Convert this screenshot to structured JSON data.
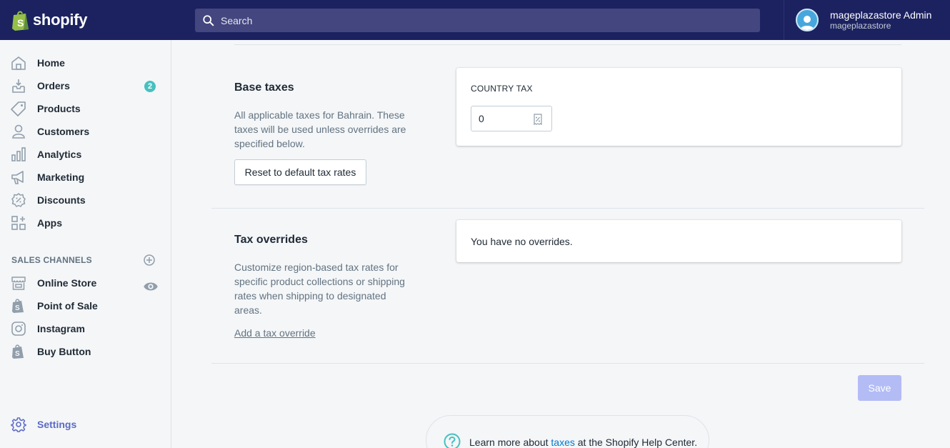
{
  "brand": {
    "name": "shopify",
    "color": "#1c2260",
    "accent": "#5c6ac4"
  },
  "search": {
    "placeholder": "Search"
  },
  "user": {
    "name": "mageplazastore Admin",
    "store": "mageplazastore"
  },
  "sidebar": {
    "items": [
      {
        "label": "Home",
        "icon": "home-icon"
      },
      {
        "label": "Orders",
        "icon": "orders-icon",
        "badge": "2"
      },
      {
        "label": "Products",
        "icon": "tag-icon"
      },
      {
        "label": "Customers",
        "icon": "person-icon"
      },
      {
        "label": "Analytics",
        "icon": "bar-chart-icon"
      },
      {
        "label": "Marketing",
        "icon": "megaphone-icon"
      },
      {
        "label": "Discounts",
        "icon": "discount-icon"
      },
      {
        "label": "Apps",
        "icon": "apps-icon"
      }
    ],
    "sales_channels_title": "SALES CHANNELS",
    "channels": [
      {
        "label": "Online Store",
        "icon": "store-icon"
      },
      {
        "label": "Point of Sale",
        "icon": "shopify-bag-icon"
      },
      {
        "label": "Instagram",
        "icon": "instagram-icon"
      },
      {
        "label": "Buy Button",
        "icon": "shopify-bag-icon"
      }
    ],
    "settings_label": "Settings"
  },
  "base_taxes": {
    "heading": "Base taxes",
    "description": "All applicable taxes for Bahrain. These taxes will be used unless overrides are specified below.",
    "reset_button": "Reset to default tax rates",
    "country_tax_label": "COUNTRY TAX",
    "country_tax_value": "0"
  },
  "tax_overrides": {
    "heading": "Tax overrides",
    "description": "Customize region-based tax rates for specific product collections or shipping rates when shipping to designated areas.",
    "add_link": "Add a tax override",
    "empty_text": "You have no overrides."
  },
  "actions": {
    "save_label": "Save"
  },
  "help": {
    "prefix": "Learn more about ",
    "link": "taxes",
    "suffix": " at the Shopify Help Center."
  }
}
